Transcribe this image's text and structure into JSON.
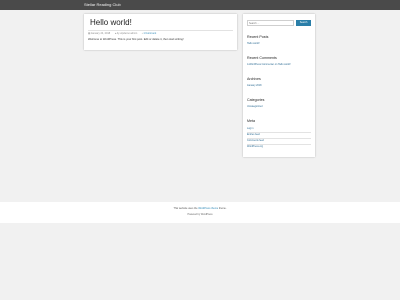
{
  "site": {
    "title": "Stellar Reading Club"
  },
  "post": {
    "title": "Hello world!",
    "date": "January 24, 2018",
    "author": "by wpdemo admin",
    "comments": "1 Comment",
    "excerpt": "Welcome to WordPress. This is your first post. Edit or delete it, then start writing!"
  },
  "sidebar": {
    "search": {
      "placeholder": "Search ...",
      "button_label": "Search"
    },
    "recent_posts": {
      "title": "Recent Posts",
      "items": [
        "Hello world!"
      ]
    },
    "recent_comments": {
      "title": "Recent Comments",
      "items": [
        "A WordPress Commenter on Hello world!"
      ]
    },
    "archives": {
      "title": "Archives",
      "items": [
        "January 2018"
      ]
    },
    "categories": {
      "title": "Categories",
      "items": [
        "Uncategorized"
      ]
    },
    "meta": {
      "title": "Meta",
      "items": [
        "Log in",
        "Entries feed",
        "Comments feed",
        "WordPress.org"
      ]
    }
  },
  "footer": {
    "line1_prefix": "This website uses the",
    "line1_link": "WordPress theme",
    "line1_suffix": "theme.",
    "line2": "Powered by WordPress"
  },
  "colors": {
    "topbar": "#4a4a4a",
    "background": "#f1f1f1",
    "card": "#ffffff",
    "accent": "#2a7ea8"
  },
  "icons": [
    "calendar-icon",
    "user-icon",
    "comment-icon"
  ]
}
